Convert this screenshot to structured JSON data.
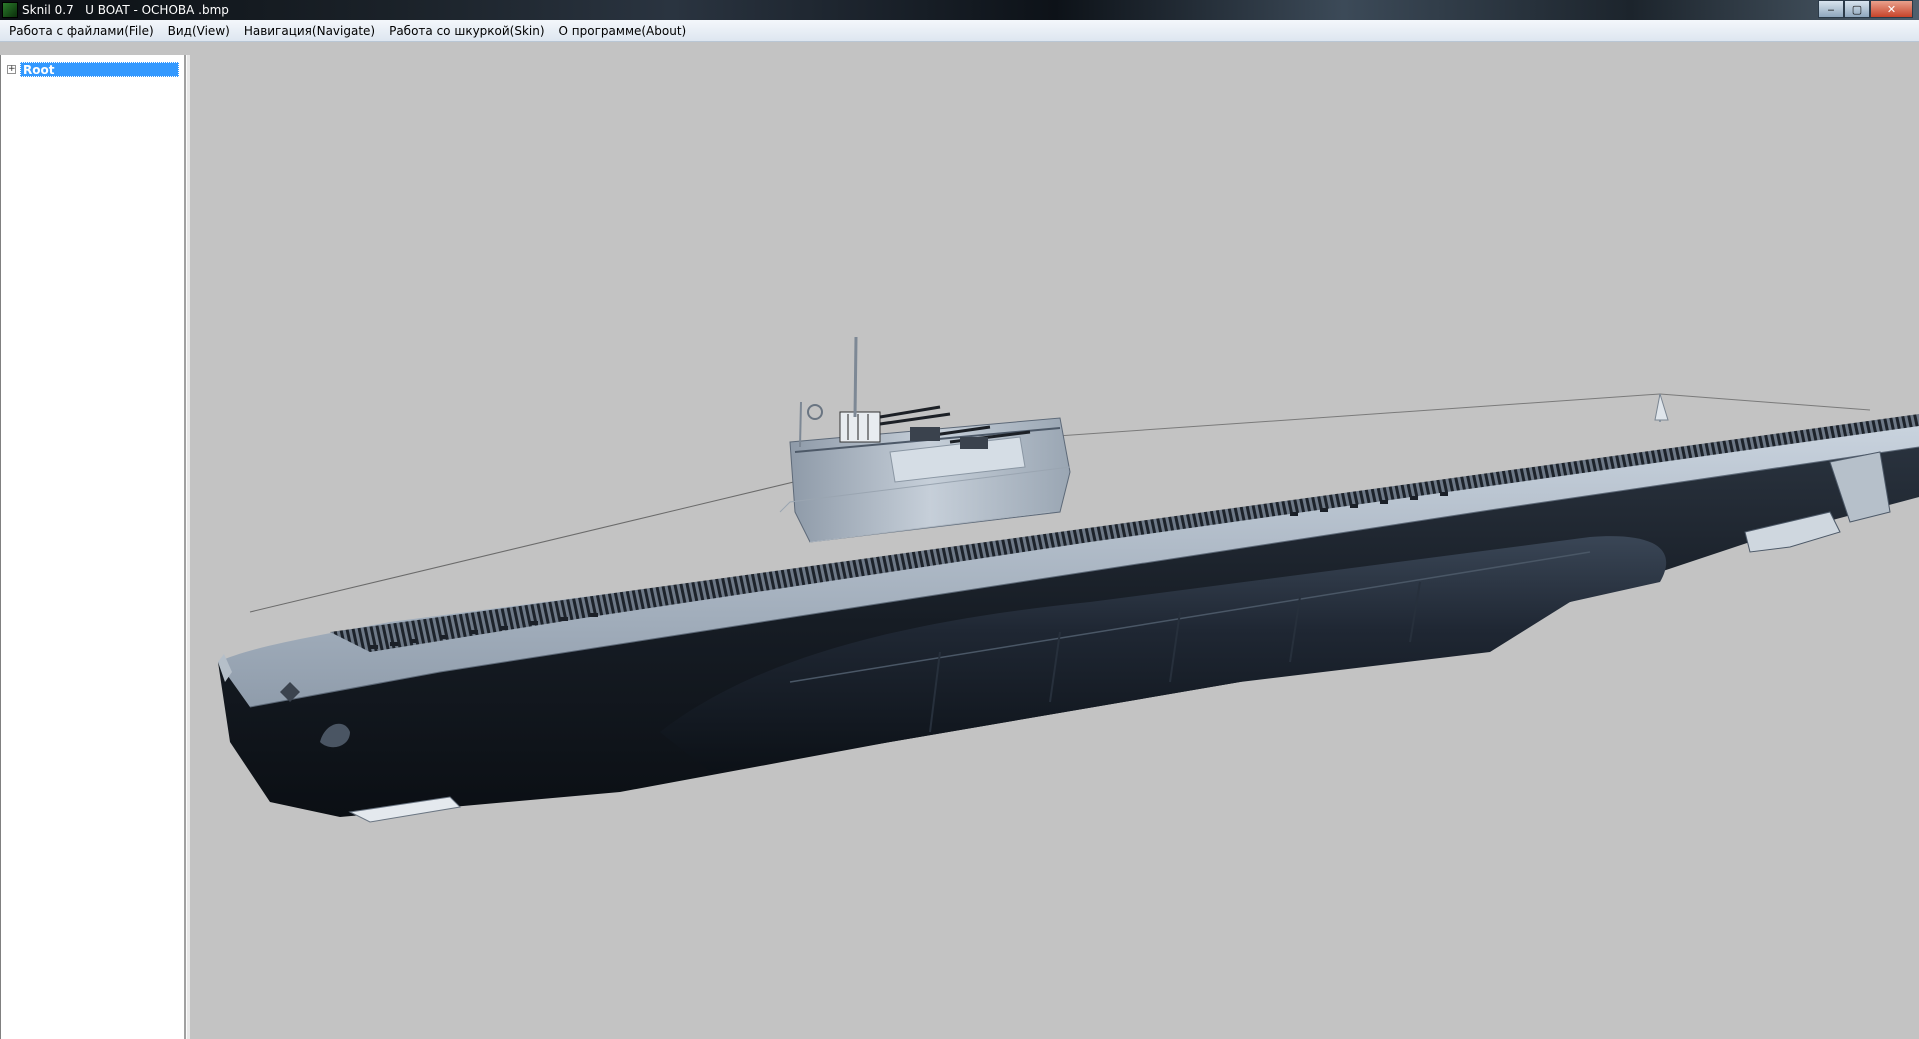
{
  "window": {
    "title": "Sknil 0.7   U BOAT - OCHOBA .bmp",
    "buttons": {
      "minimize": "‒",
      "maximize": "▢",
      "close": "✕"
    }
  },
  "menu": {
    "items": [
      "Работа с файлами(File)",
      "Вид(View)",
      "Навигация(Navigate)",
      "Работа со шкуркой(Skin)",
      "О программе(About)"
    ]
  },
  "tree": {
    "expander": "+",
    "root_label": "Root"
  },
  "viewport": {
    "background": "#c3c3c3",
    "model": "u-boat"
  }
}
